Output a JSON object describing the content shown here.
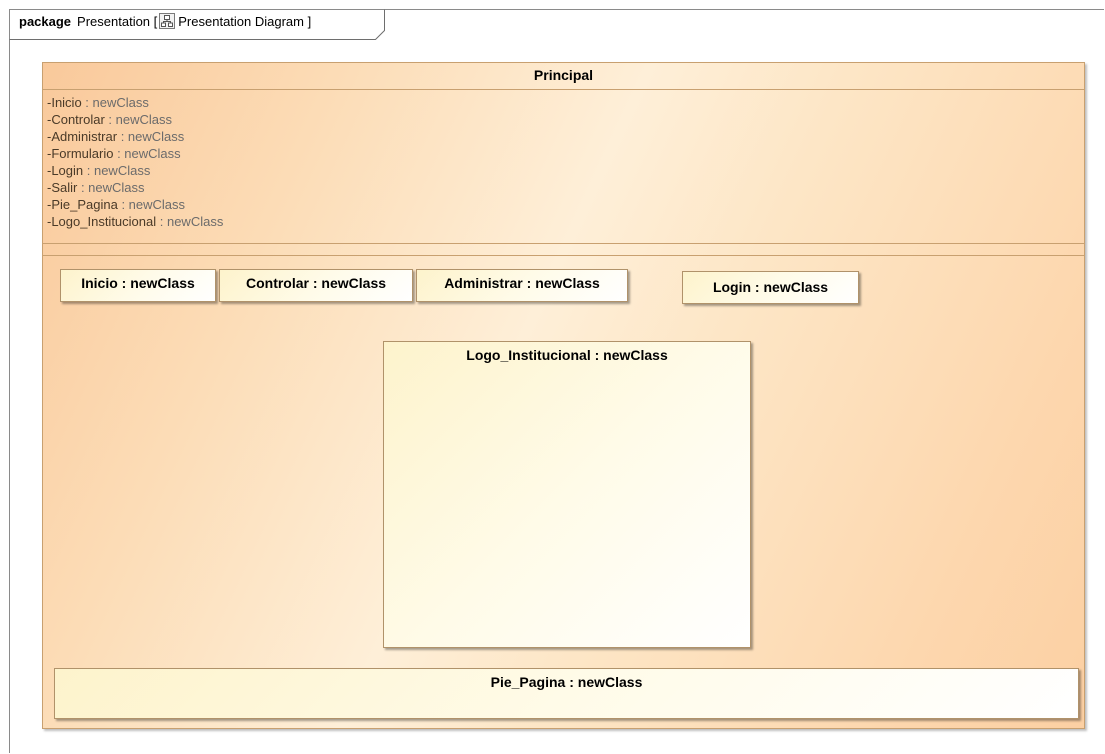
{
  "frame": {
    "keyword": "package",
    "name": "Presentation [",
    "icon": "class-diagram-icon",
    "diagram": "Presentation Diagram ]"
  },
  "principal": {
    "title": "Principal",
    "attributes": [
      {
        "name": "-Inicio",
        "type": " : newClass"
      },
      {
        "name": "-Controlar",
        "type": " : newClass"
      },
      {
        "name": "-Administrar",
        "type": " : newClass"
      },
      {
        "name": "-Formulario",
        "type": " : newClass"
      },
      {
        "name": "-Login",
        "type": " : newClass"
      },
      {
        "name": "-Salir",
        "type": " : newClass"
      },
      {
        "name": "-Pie_Pagina",
        "type": " : newClass"
      },
      {
        "name": "-Logo_Institucional",
        "type": " : newClass"
      }
    ],
    "parts": {
      "inicio": "Inicio : newClass",
      "controlar": "Controlar : newClass",
      "administrar": "Administrar : newClass",
      "login": "Login : newClass",
      "logo": "Logo_Institucional : newClass",
      "pie": "Pie_Pagina : newClass"
    }
  }
}
